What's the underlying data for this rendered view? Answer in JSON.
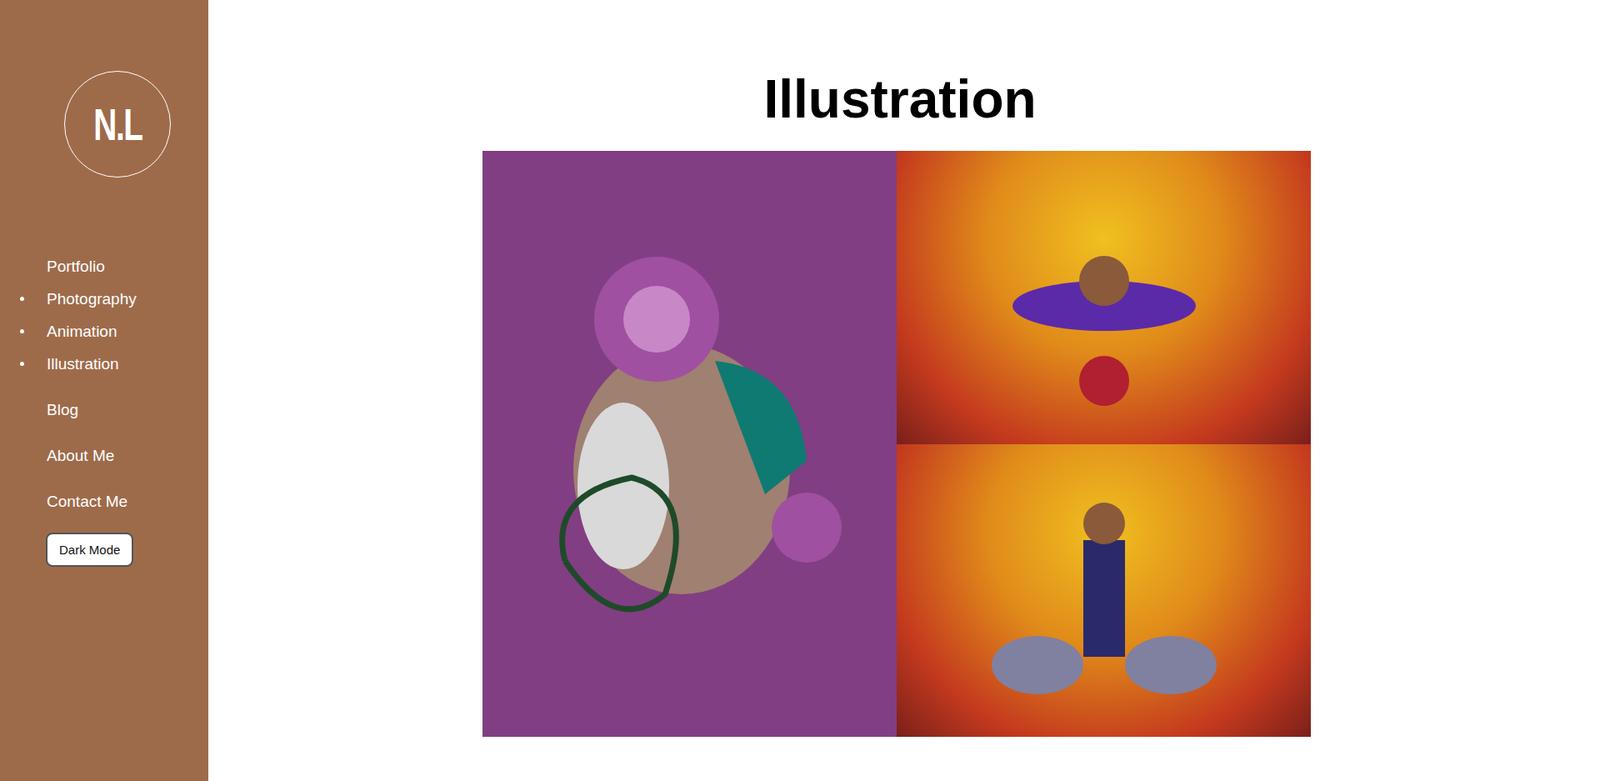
{
  "sidebar": {
    "logo": "N.L",
    "items": [
      {
        "label": "Portfolio",
        "kind": "link"
      },
      {
        "label": "Photography",
        "kind": "sub"
      },
      {
        "label": "Animation",
        "kind": "sub"
      },
      {
        "label": "Illustration",
        "kind": "sub"
      },
      {
        "label": "Blog",
        "kind": "link"
      },
      {
        "label": "About Me",
        "kind": "link"
      },
      {
        "label": "Contact Me",
        "kind": "link"
      }
    ],
    "button": "Dark Mode"
  },
  "main": {
    "title": "Illustration"
  }
}
